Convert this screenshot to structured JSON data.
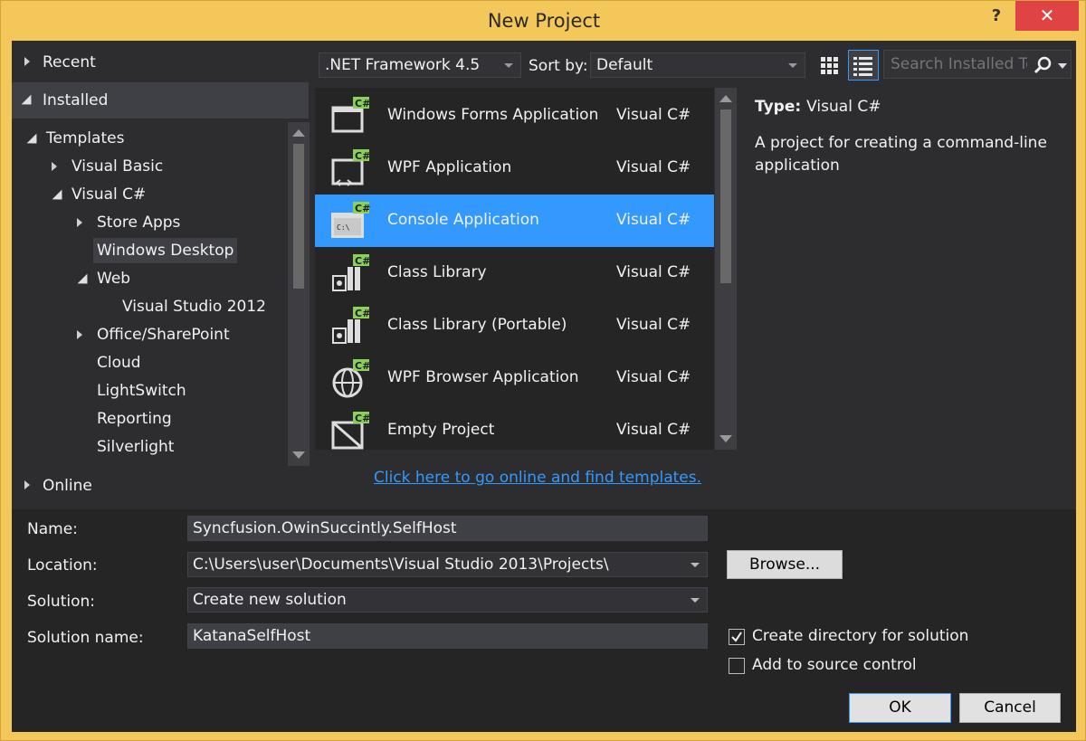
{
  "window": {
    "title": "New Project",
    "help_label": "?",
    "close_label": "✕"
  },
  "left": {
    "recent": "Recent",
    "installed": "Installed",
    "online": "Online",
    "tree": [
      {
        "label": "Templates",
        "level": 0,
        "expander": "open"
      },
      {
        "label": "Visual Basic",
        "level": 1,
        "expander": "closed"
      },
      {
        "label": "Visual C#",
        "level": 1,
        "expander": "open"
      },
      {
        "label": "Store Apps",
        "level": 2,
        "expander": "closed"
      },
      {
        "label": "Windows Desktop",
        "level": 2,
        "expander": "none",
        "selected": true
      },
      {
        "label": "Web",
        "level": 2,
        "expander": "open"
      },
      {
        "label": "Visual Studio 2012",
        "level": 3,
        "expander": "none"
      },
      {
        "label": "Office/SharePoint",
        "level": 2,
        "expander": "closed"
      },
      {
        "label": "Cloud",
        "level": 2,
        "expander": "none"
      },
      {
        "label": "LightSwitch",
        "level": 2,
        "expander": "none"
      },
      {
        "label": "Reporting",
        "level": 2,
        "expander": "none"
      },
      {
        "label": "Silverlight",
        "level": 2,
        "expander": "none"
      }
    ]
  },
  "toolbar": {
    "framework": ".NET Framework 4.5",
    "sort_by_label": "Sort by:",
    "sort_by_value": "Default",
    "search_placeholder": "Search Installed Te"
  },
  "templates": [
    {
      "name": "Windows Forms Application",
      "lang": "Visual C#",
      "icon": "winforms-icon"
    },
    {
      "name": "WPF Application",
      "lang": "Visual C#",
      "icon": "wpf-icon"
    },
    {
      "name": "Console Application",
      "lang": "Visual C#",
      "icon": "console-icon",
      "selected": true
    },
    {
      "name": "Class Library",
      "lang": "Visual C#",
      "icon": "class-library-icon"
    },
    {
      "name": "Class Library (Portable)",
      "lang": "Visual C#",
      "icon": "class-library-portable-icon"
    },
    {
      "name": "WPF Browser Application",
      "lang": "Visual C#",
      "icon": "wpf-browser-icon"
    },
    {
      "name": "Empty Project",
      "lang": "Visual C#",
      "icon": "empty-project-icon"
    }
  ],
  "details": {
    "type_key": "Type:",
    "type_value": "Visual C#",
    "description": "A project for creating a command-line application"
  },
  "online_link": "Click here to go online and find templates.",
  "form": {
    "name_label": "Name:",
    "name_value": "Syncfusion.OwinSuccintly.SelfHost",
    "location_label": "Location:",
    "location_value": "C:\\Users\\user\\Documents\\Visual Studio 2013\\Projects\\",
    "solution_label": "Solution:",
    "solution_value": "Create new solution",
    "solution_name_label": "Solution name:",
    "solution_name_value": "KatanaSelfHost",
    "browse_label": "Browse...",
    "create_dir_label": "Create directory for solution",
    "create_dir_checked": true,
    "source_control_label": "Add to source control",
    "source_control_checked": false,
    "ok_label": "OK",
    "cancel_label": "Cancel"
  },
  "colors": {
    "title_bar": "#f3c759",
    "client_bg": "#2d2d30",
    "selection": "#3399ff",
    "close_button": "#e04343",
    "csharp_badge": "#8bd05a"
  }
}
